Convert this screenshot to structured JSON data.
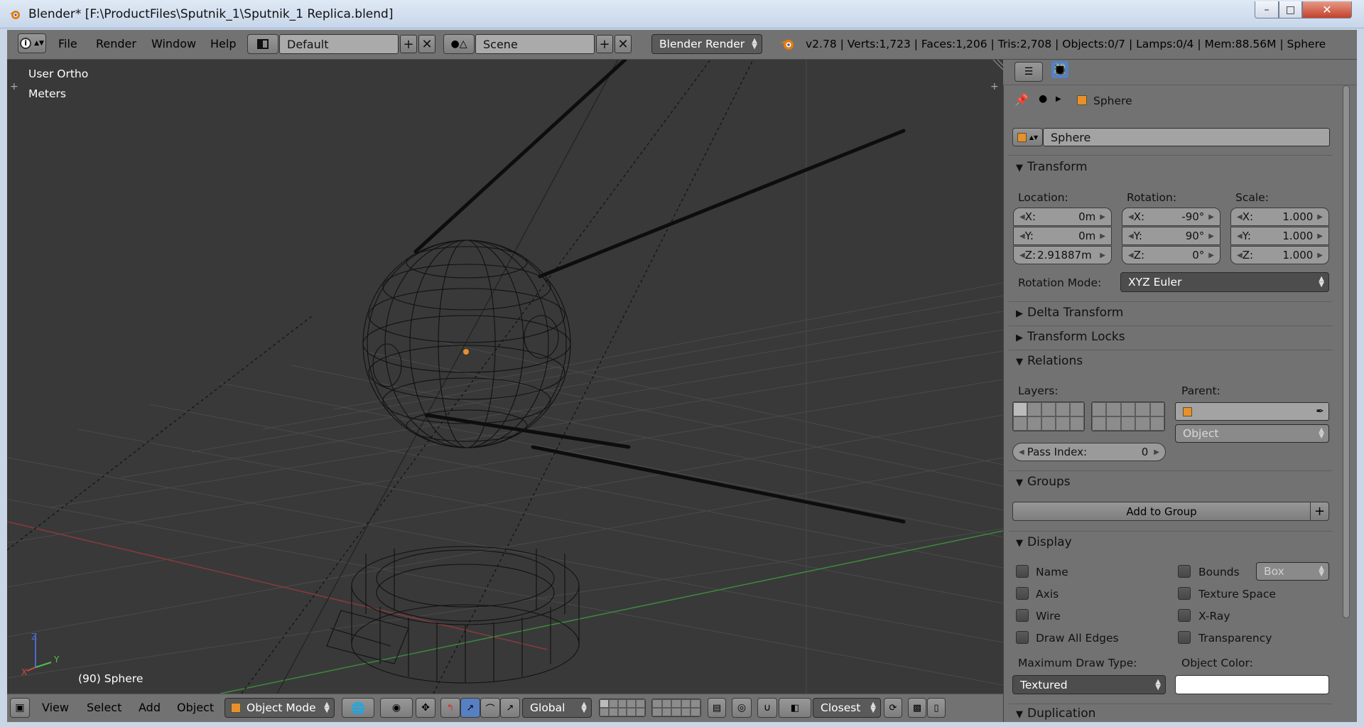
{
  "window": {
    "title": "Blender* [F:\\ProductFiles\\Sputnik_1\\Sputnik_1 Replica.blend]",
    "minimize": "–",
    "maximize": "□",
    "close": "✕"
  },
  "topbar": {
    "menus": [
      "File",
      "Render",
      "Window",
      "Help"
    ],
    "screen_layout": "Default",
    "scene": "Scene",
    "render_engine": "Blender Render",
    "stats": "v2.78 | Verts:1,723 | Faces:1,206 | Tris:2,708 | Objects:0/7 | Lamps:0/4 | Mem:88.56M | Sphere"
  },
  "viewport": {
    "view_name": "User Ortho",
    "units": "Meters",
    "object_info": "(90) Sphere",
    "axis_labels": {
      "x": "X",
      "y": "Y",
      "z": "Z"
    }
  },
  "bottombar": {
    "menus": [
      "View",
      "Select",
      "Add",
      "Object"
    ],
    "mode": "Object Mode",
    "orientation": "Global",
    "snap_target": "Closest"
  },
  "properties": {
    "breadcrumb_object": "Sphere",
    "object_name": "Sphere",
    "transform": {
      "header": "Transform",
      "location_label": "Location:",
      "rotation_label": "Rotation:",
      "scale_label": "Scale:",
      "location": {
        "x": "0m",
        "y": "0m",
        "z": "2.91887m"
      },
      "rotation": {
        "x": "-90°",
        "y": "90°",
        "z": "0°"
      },
      "scale": {
        "x": "1.000",
        "y": "1.000",
        "z": "1.000"
      },
      "axis_x": "X:",
      "axis_y": "Y:",
      "axis_z": "Z:",
      "rotation_mode_label": "Rotation Mode:",
      "rotation_mode": "XYZ Euler"
    },
    "delta_transform": "Delta Transform",
    "transform_locks": "Transform Locks",
    "relations": {
      "header": "Relations",
      "layers_label": "Layers:",
      "parent_label": "Parent:",
      "parent_type": "Object",
      "pass_index_label": "Pass Index:",
      "pass_index": "0"
    },
    "groups": {
      "header": "Groups",
      "add_button": "Add to Group"
    },
    "display": {
      "header": "Display",
      "name": "Name",
      "axis": "Axis",
      "wire": "Wire",
      "draw_all_edges": "Draw All Edges",
      "bounds": "Bounds",
      "bounds_type": "Box",
      "texture_space": "Texture Space",
      "xray": "X-Ray",
      "transparency": "Transparency",
      "max_draw_type_label": "Maximum Draw Type:",
      "max_draw_type": "Textured",
      "object_color_label": "Object Color:",
      "object_color": "#ffffff"
    },
    "duplication": "Duplication"
  },
  "colors": {
    "viewport_bg": "#393939",
    "panel_bg": "#727272",
    "x_axis": "#b03a3a",
    "y_axis": "#3fa03f",
    "selected_origin": "#e8902a"
  }
}
